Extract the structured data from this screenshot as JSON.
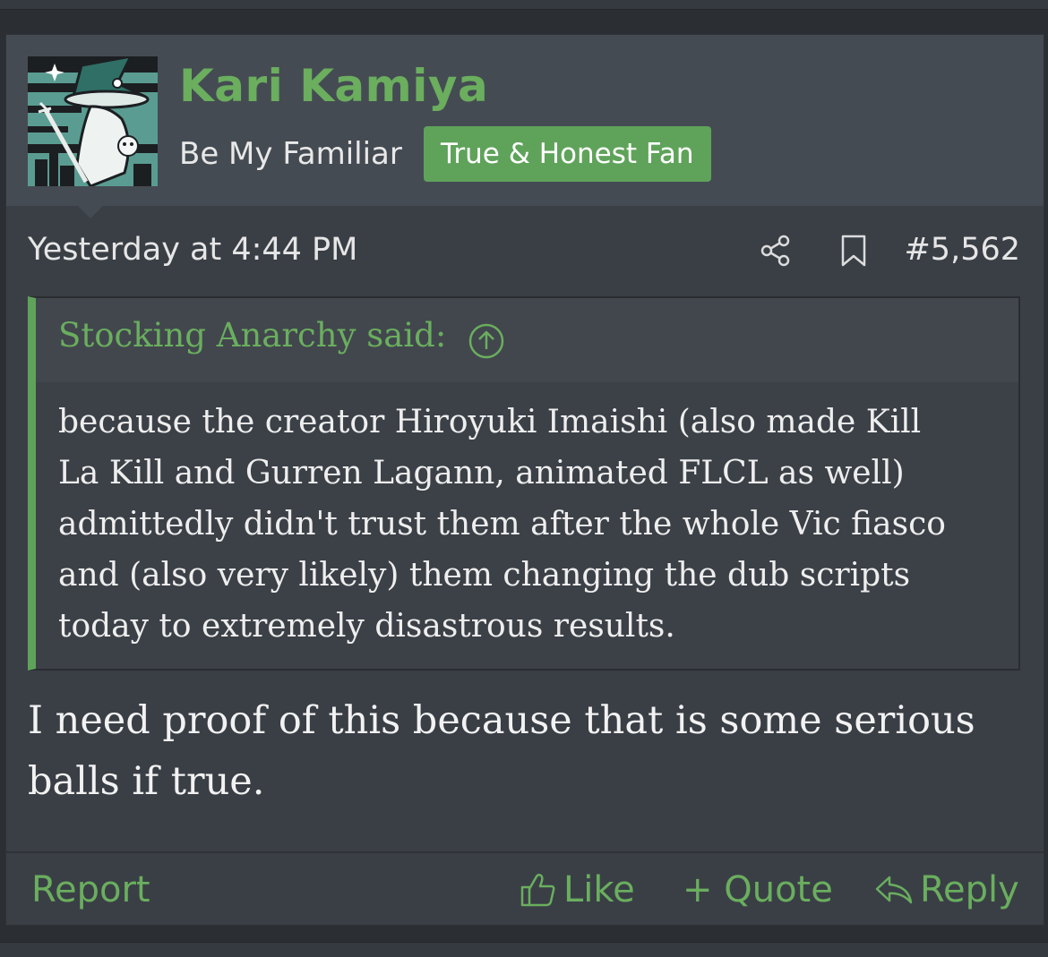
{
  "post": {
    "author": {
      "name": "Kari Kamiya",
      "title": "Be My Familiar",
      "banner": "True & Honest Fan",
      "avatar_icon": "witch-avatar"
    },
    "meta": {
      "date": "Yesterday at 4:44 PM",
      "post_number": "#5,562",
      "share_icon": "share-icon",
      "bookmark_icon": "bookmark-icon"
    },
    "quote": {
      "attribution": "Stocking Anarchy said:",
      "jump_icon": "arrow-up-circle-icon",
      "lines": [
        "because the creator Hiroyuki Imaishi (also made Kill",
        "La Kill and Gurren Lagann, animated FLCL as well)",
        "admittedly didn't trust them after the whole Vic fiasco",
        "and (also very likely) them changing the dub scripts",
        "today to extremely disastrous results."
      ]
    },
    "body_lines": [
      "I need proof of this because that is some serious",
      "balls if true."
    ],
    "footer": {
      "report": "Report",
      "like": "Like",
      "quote": "+ Quote",
      "reply": "Reply"
    }
  },
  "colors": {
    "accent": "#6aae5e",
    "banner_bg": "#5fa35a",
    "post_bg": "#3a3f46",
    "header_bg": "#454b53"
  }
}
